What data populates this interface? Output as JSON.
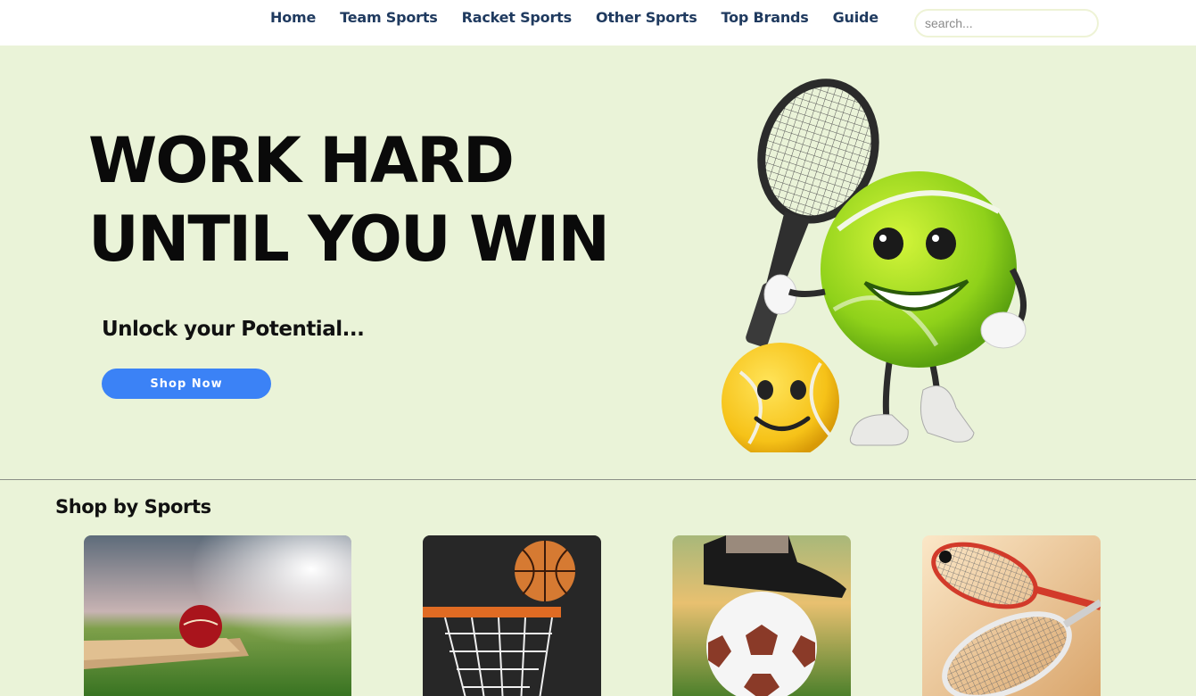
{
  "nav": {
    "links": [
      {
        "label": "Home"
      },
      {
        "label": "Team Sports"
      },
      {
        "label": "Racket Sports"
      },
      {
        "label": "Other Sports"
      },
      {
        "label": "Top Brands"
      },
      {
        "label": "Guide"
      }
    ],
    "search_placeholder": "search..."
  },
  "hero": {
    "headline_line1": "WORK HARD",
    "headline_line2": "UNTIL YOU WIN",
    "subheading": "Unlock your Potential...",
    "cta_label": "Shop Now"
  },
  "shop_by_sports": {
    "title": "Shop by Sports",
    "cards": [
      {
        "icon": "cricket-image"
      },
      {
        "icon": "basketball-image"
      },
      {
        "icon": "football-image"
      },
      {
        "icon": "squash-image"
      }
    ]
  },
  "colors": {
    "background": "#eaf3d8",
    "nav_text": "#1f3a5f",
    "cta": "#3b82f6"
  }
}
